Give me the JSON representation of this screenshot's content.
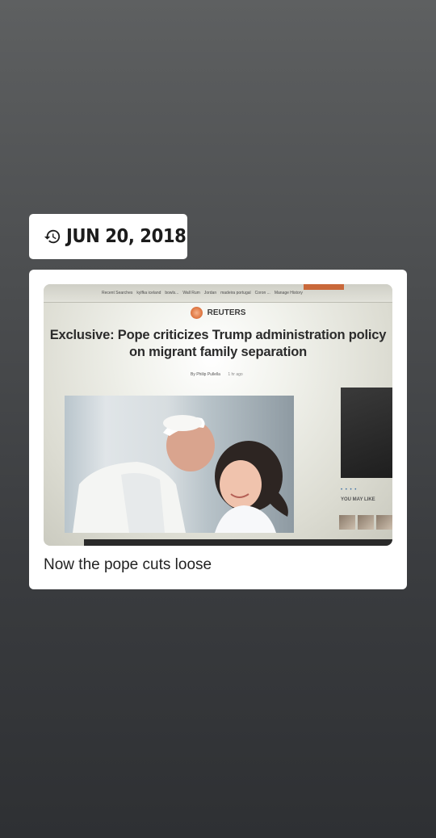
{
  "date_badge": {
    "icon": "history-icon",
    "date": "JUN 20, 2018"
  },
  "post": {
    "photo": {
      "browser": {
        "recent_searches": [
          "Recent Searches",
          "kylfka iceland",
          "bowls...",
          "Wall Rum",
          "Jordan",
          "madeira portugal",
          "Coron ...",
          "Manage History"
        ]
      },
      "source": "REUTERS",
      "headline_line1": "Exclusive: Pope criticizes Trump administration policy",
      "headline_line2": "on migrant family separation",
      "byline": "By Philip Pullella",
      "time_ago": "1 hr ago",
      "dots": "• • • •",
      "you_may_like": "YOU MAY LIKE"
    },
    "caption": "Now the pope cuts loose"
  }
}
